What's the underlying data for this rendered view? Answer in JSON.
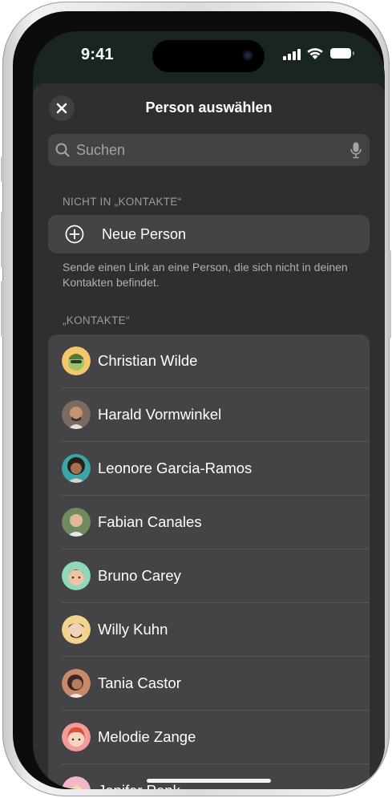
{
  "status_bar": {
    "time": "9:41"
  },
  "sheet": {
    "title": "Person auswählen",
    "close_icon": "close-icon",
    "search": {
      "placeholder": "Suchen",
      "value": "",
      "icon": "search-icon",
      "mic_icon": "microphone-icon"
    },
    "not_in_contacts": {
      "header": "NICHT IN „KONTAKTE“",
      "new_person_label": "Neue Person",
      "new_person_icon": "plus-circle-icon",
      "hint": "Sende einen Link an eine Person, die sich nicht in deinen Kontakten befindet."
    },
    "contacts": {
      "header": "„KONTAKTE“",
      "items": [
        {
          "name": "Christian Wilde",
          "avatar_bg": "#f5c76b"
        },
        {
          "name": "Harald Vormwinkel",
          "avatar_bg": "#7a6a62"
        },
        {
          "name": "Leonore Garcia-Ramos",
          "avatar_bg": "#3aa6a8"
        },
        {
          "name": "Fabian Canales",
          "avatar_bg": "#6f8a5e"
        },
        {
          "name": "Bruno Carey",
          "avatar_bg": "#8fd8b8"
        },
        {
          "name": "Willy Kuhn",
          "avatar_bg": "#f3d48a"
        },
        {
          "name": "Tania Castor",
          "avatar_bg": "#c98a6b"
        },
        {
          "name": "Melodie Zange",
          "avatar_bg": "#f39a9a"
        },
        {
          "name": "Jenifer Penk",
          "avatar_bg": "#f2b8c8"
        }
      ]
    }
  }
}
